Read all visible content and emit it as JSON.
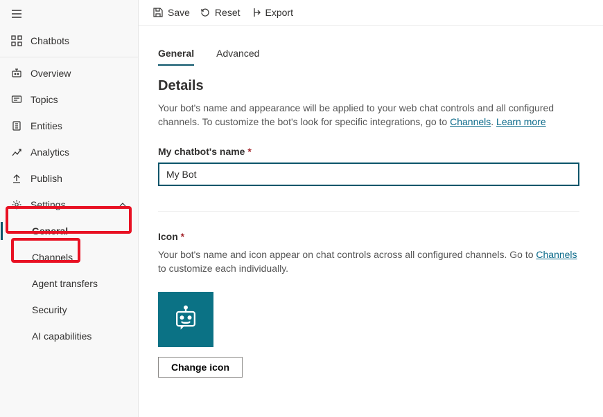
{
  "toolbar": {
    "save_label": "Save",
    "reset_label": "Reset",
    "export_label": "Export"
  },
  "sidebar": {
    "chatbots_label": "Chatbots",
    "overview_label": "Overview",
    "topics_label": "Topics",
    "entities_label": "Entities",
    "analytics_label": "Analytics",
    "publish_label": "Publish",
    "settings_label": "Settings",
    "sub": {
      "general": "General",
      "channels": "Channels",
      "agent_transfers": "Agent transfers",
      "security": "Security",
      "ai_capabilities": "AI capabilities"
    }
  },
  "tabs": {
    "general": "General",
    "advanced": "Advanced"
  },
  "details": {
    "heading": "Details",
    "desc_prefix": "Your bot's name and appearance will be applied to your web chat controls and all configured channels. To customize the bot's look for specific integrations, go to ",
    "channels_link": "Channels",
    "desc_sep": ". ",
    "learn_more": "Learn more",
    "name_label": "My chatbot's name ",
    "name_value": "My Bot",
    "icon_label": "Icon ",
    "icon_desc_prefix": "Your bot's name and icon appear on chat controls across all configured channels. Go to ",
    "icon_channels_link": "Channels",
    "icon_desc_suffix": " to customize each individually.",
    "change_icon_label": "Change icon"
  }
}
